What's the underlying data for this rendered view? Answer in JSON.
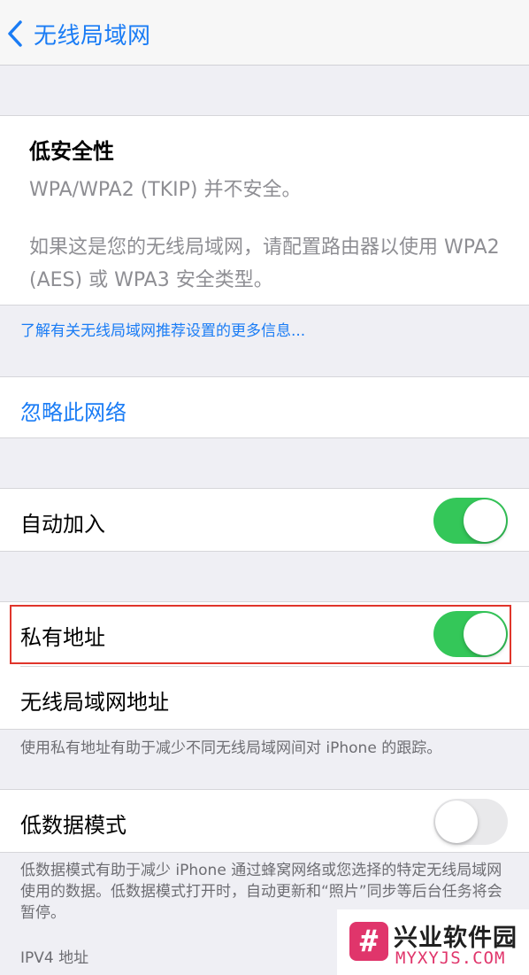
{
  "navbar": {
    "back_label": "无线局域网"
  },
  "security_warning": {
    "title": "低安全性",
    "subtitle": "WPA/WPA2 (TKIP) 并不安全。",
    "body": "如果这是您的无线局域网，请配置路由器以使用 WPA2 (AES) 或 WPA3 安全类型。"
  },
  "learn_more_link": "了解有关无线局域网推荐设置的更多信息...",
  "forget_network": "忽略此网络",
  "auto_join": {
    "label": "自动加入",
    "enabled": true
  },
  "private_address": {
    "label": "私有地址",
    "enabled": true
  },
  "wifi_address": {
    "label": "无线局域网地址"
  },
  "private_address_footer": "使用私有地址有助于减少不同无线局域网间对 iPhone 的跟踪。",
  "low_data_mode": {
    "label": "低数据模式",
    "enabled": false
  },
  "low_data_footer": "低数据模式有助于减少 iPhone 通过蜂窝网络或您选择的特定无线局域网使用的数据。低数据模式打开时，自动更新和“照片”同步等后台任务将会暂停。",
  "ipv4_section_header": "IPV4 地址",
  "watermark": {
    "badge": "#",
    "name": "兴业软件园",
    "url": "MYXYJS.COM"
  },
  "colors": {
    "accent": "#1a7cf5",
    "toggle_on": "#34c759",
    "highlight": "#e0352b"
  }
}
